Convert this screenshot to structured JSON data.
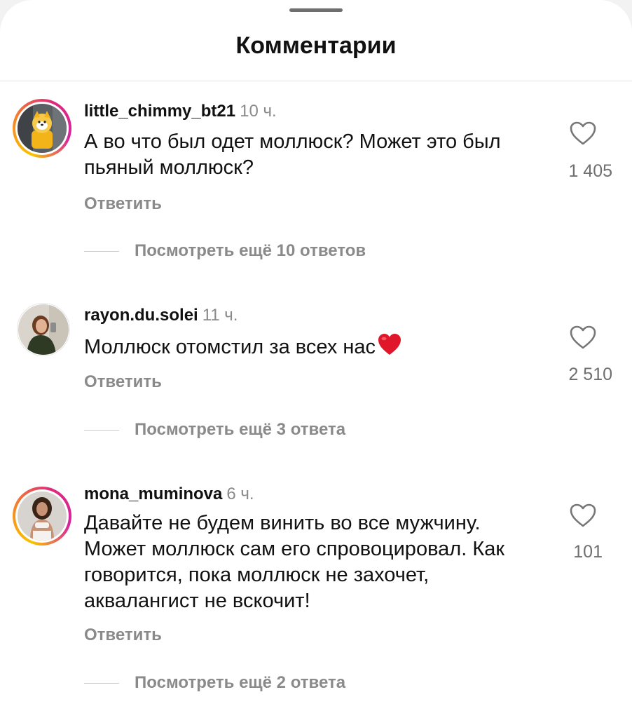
{
  "header": {
    "title": "Комментарии"
  },
  "comments": [
    {
      "username": "little_chimmy_bt21",
      "time": "10 ч.",
      "text": "А во что был одет моллюск? Может это был пьяный моллюск?",
      "reply_label": "Ответить",
      "likes": "1 405",
      "view_replies": "Посмотреть ещё 10 ответов",
      "story_ring": true
    },
    {
      "username": "rayon.du.solei",
      "time": "11 ч.",
      "text": "Моллюск отомстил за всех нас",
      "emoji": "red-heart",
      "reply_label": "Ответить",
      "likes": "2 510",
      "view_replies": "Посмотреть ещё 3 ответа",
      "story_ring": false
    },
    {
      "username": "mona_muminova",
      "time": "6 ч.",
      "text": "Давайте не будем винить во все мужчину. Может моллюск сам его спровоцировал. Как говорится, пока моллюск не захочет, аквалангист не вскочит!",
      "reply_label": "Ответить",
      "likes": "101",
      "view_replies": "Посмотреть ещё 2 ответа",
      "story_ring": true
    }
  ],
  "icons": {
    "like": "heart-outline-icon",
    "emoji": "red-heart-emoji"
  },
  "colors": {
    "muted": "#8a8a8a",
    "heart_emoji": "#e0162b"
  }
}
